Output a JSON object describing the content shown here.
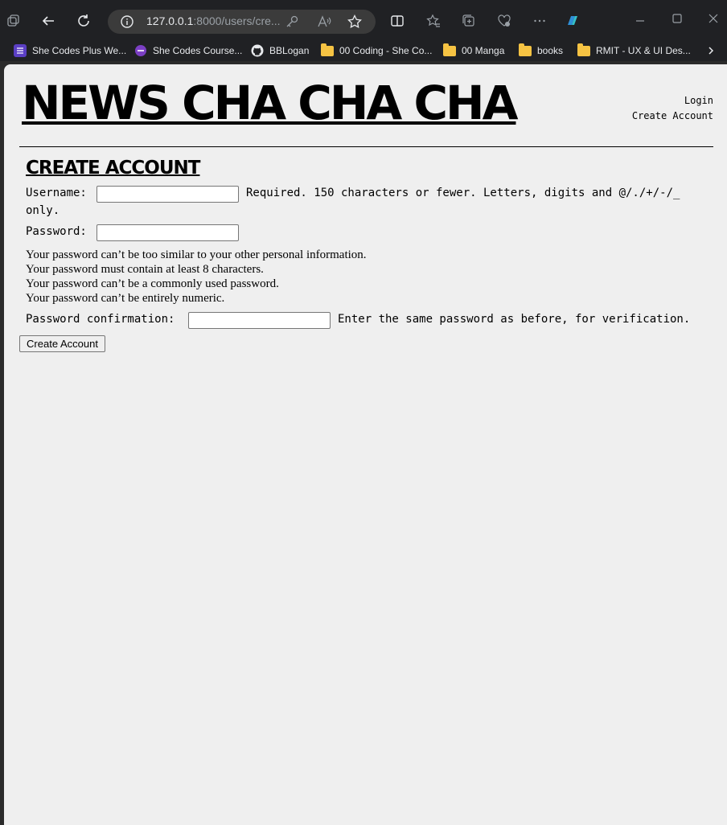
{
  "browser": {
    "url_host": "127.0.0.1",
    "url_rest": ":8000/users/cre...",
    "bookmarks": [
      {
        "label": "She Codes Plus We...",
        "icon": "list-icon"
      },
      {
        "label": "She Codes Course...",
        "icon": "circle-icon"
      },
      {
        "label": "BBLogan",
        "icon": "github-icon"
      },
      {
        "label": "00 Coding - She Co...",
        "icon": "folder-icon"
      },
      {
        "label": "00 Manga",
        "icon": "folder-icon"
      },
      {
        "label": "books",
        "icon": "folder-icon"
      },
      {
        "label": "RMIT - UX & UI Des...",
        "icon": "folder-icon"
      }
    ]
  },
  "site": {
    "title": "NEWS CHA CHA CHA",
    "nav": {
      "login": "Login",
      "create_account": "Create Account"
    }
  },
  "form": {
    "heading": "CREATE ACCOUNT",
    "username_label": "Username:",
    "username_value": "",
    "username_help_1": "Required. 150 characters or fewer. Letters, digits and @/./+/-/_",
    "username_help_2": "only.",
    "password_label": "Password:",
    "password_value": "",
    "password_rules": [
      "Your password can’t be too similar to your other personal information.",
      "Your password must contain at least 8 characters.",
      "Your password can’t be a commonly used password.",
      "Your password can’t be entirely numeric."
    ],
    "confirm_label": "Password confirmation:",
    "confirm_value": "",
    "confirm_help": "Enter the same password as before, for verification.",
    "submit_label": "Create Account"
  },
  "colors": {
    "chrome": "#202124",
    "page_bg": "#efefef",
    "folder": "#f6c343"
  }
}
